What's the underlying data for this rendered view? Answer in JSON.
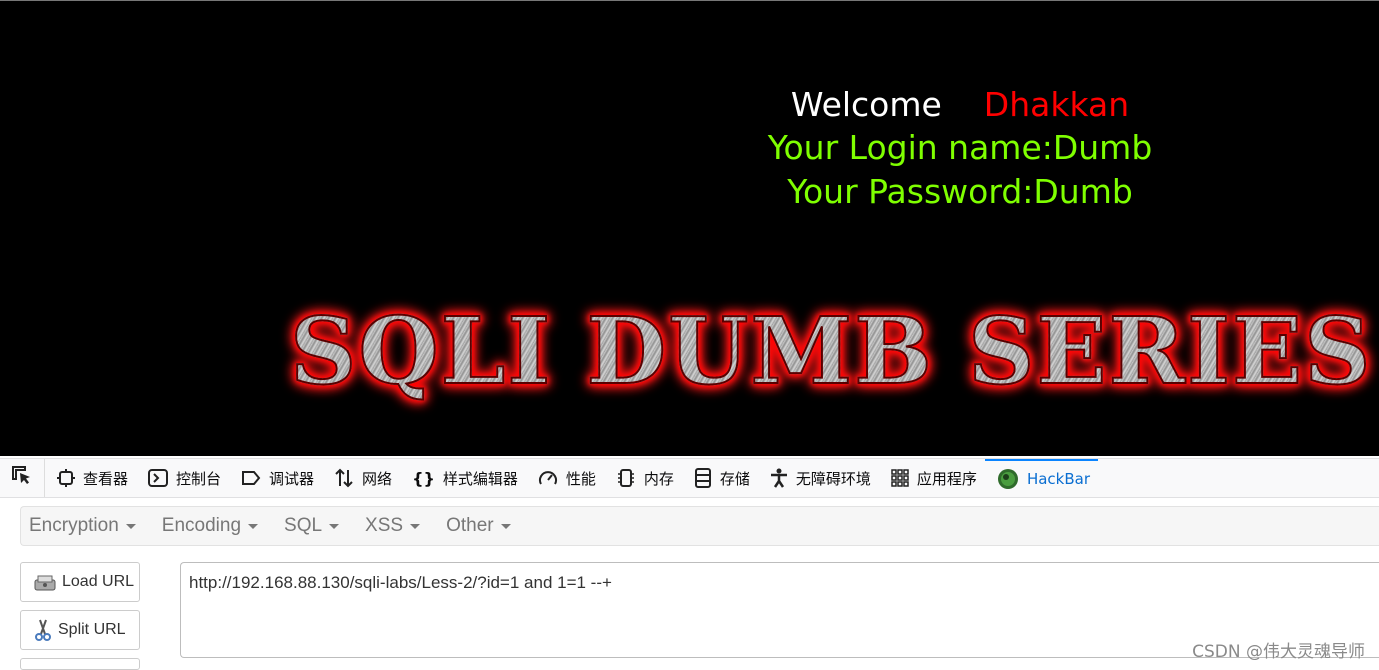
{
  "page": {
    "welcome_label": "Welcome",
    "welcome_name": "Dhakkan",
    "login_line": "Your Login name:Dumb",
    "password_line": "Your Password:Dumb",
    "banner": "SQLI DUMB SERIES",
    "colors": {
      "background": "#000000",
      "green": "#7fff00",
      "red": "#ff0000"
    }
  },
  "devtools": {
    "tabs": [
      {
        "label": "查看器",
        "icon": "inspector-icon"
      },
      {
        "label": "控制台",
        "icon": "console-icon"
      },
      {
        "label": "调试器",
        "icon": "debugger-icon"
      },
      {
        "label": "网络",
        "icon": "network-icon"
      },
      {
        "label": "样式编辑器",
        "icon": "style-editor-icon"
      },
      {
        "label": "性能",
        "icon": "performance-icon"
      },
      {
        "label": "内存",
        "icon": "memory-icon"
      },
      {
        "label": "存储",
        "icon": "storage-icon"
      },
      {
        "label": "无障碍环境",
        "icon": "accessibility-icon"
      },
      {
        "label": "应用程序",
        "icon": "application-icon"
      },
      {
        "label": "HackBar",
        "icon": "hackbar-icon",
        "active": true
      }
    ]
  },
  "hackbar": {
    "menu": [
      "Encryption",
      "Encoding",
      "SQL",
      "XSS",
      "Other"
    ],
    "buttons": {
      "load": "Load URL",
      "split": "Split URL"
    },
    "url": "http://192.168.88.130/sqli-labs/Less-2/?id=1 and 1=1 --+"
  },
  "watermark": "CSDN @伟大灵魂导师"
}
